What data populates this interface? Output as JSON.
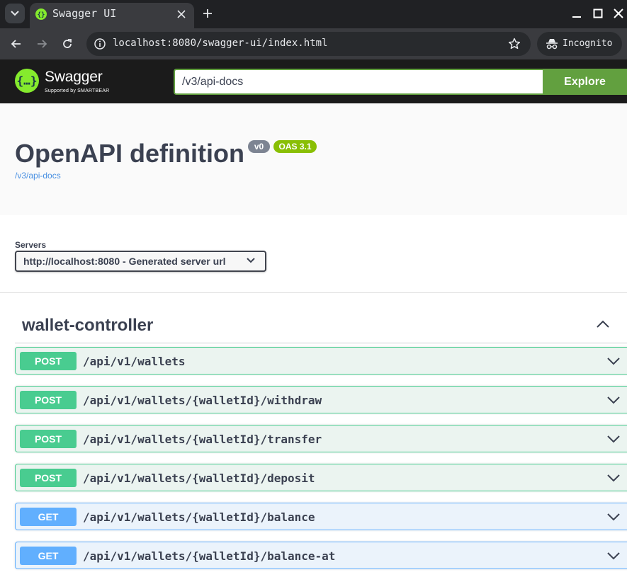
{
  "browser": {
    "tab_title": "Swagger UI",
    "url": "localhost:8080/swagger-ui/index.html",
    "incognito_label": "Incognito"
  },
  "topbar": {
    "logo_text": "Swagger",
    "logo_subtext": "Supported by SMARTBEAR",
    "spec_url": "/v3/api-docs",
    "explore_label": "Explore"
  },
  "info": {
    "title": "OpenAPI definition",
    "version": "v0",
    "oas_version": "OAS 3.1",
    "spec_link": "/v3/api-docs"
  },
  "servers": {
    "label": "Servers",
    "selected": "http://localhost:8080 - Generated server url"
  },
  "tag": {
    "name": "wallet-controller"
  },
  "operations": [
    {
      "method": "POST",
      "path": "/api/v1/wallets"
    },
    {
      "method": "POST",
      "path": "/api/v1/wallets/{walletId}/withdraw"
    },
    {
      "method": "POST",
      "path": "/api/v1/wallets/{walletId}/transfer"
    },
    {
      "method": "POST",
      "path": "/api/v1/wallets/{walletId}/deposit"
    },
    {
      "method": "GET",
      "path": "/api/v1/wallets/{walletId}/balance"
    },
    {
      "method": "GET",
      "path": "/api/v1/wallets/{walletId}/balance-at"
    }
  ],
  "colors": {
    "post": "#49cc90",
    "get": "#61affe",
    "swagger_green": "#62a03f",
    "oas_badge": "#89bf04",
    "version_badge": "#7d8492"
  }
}
